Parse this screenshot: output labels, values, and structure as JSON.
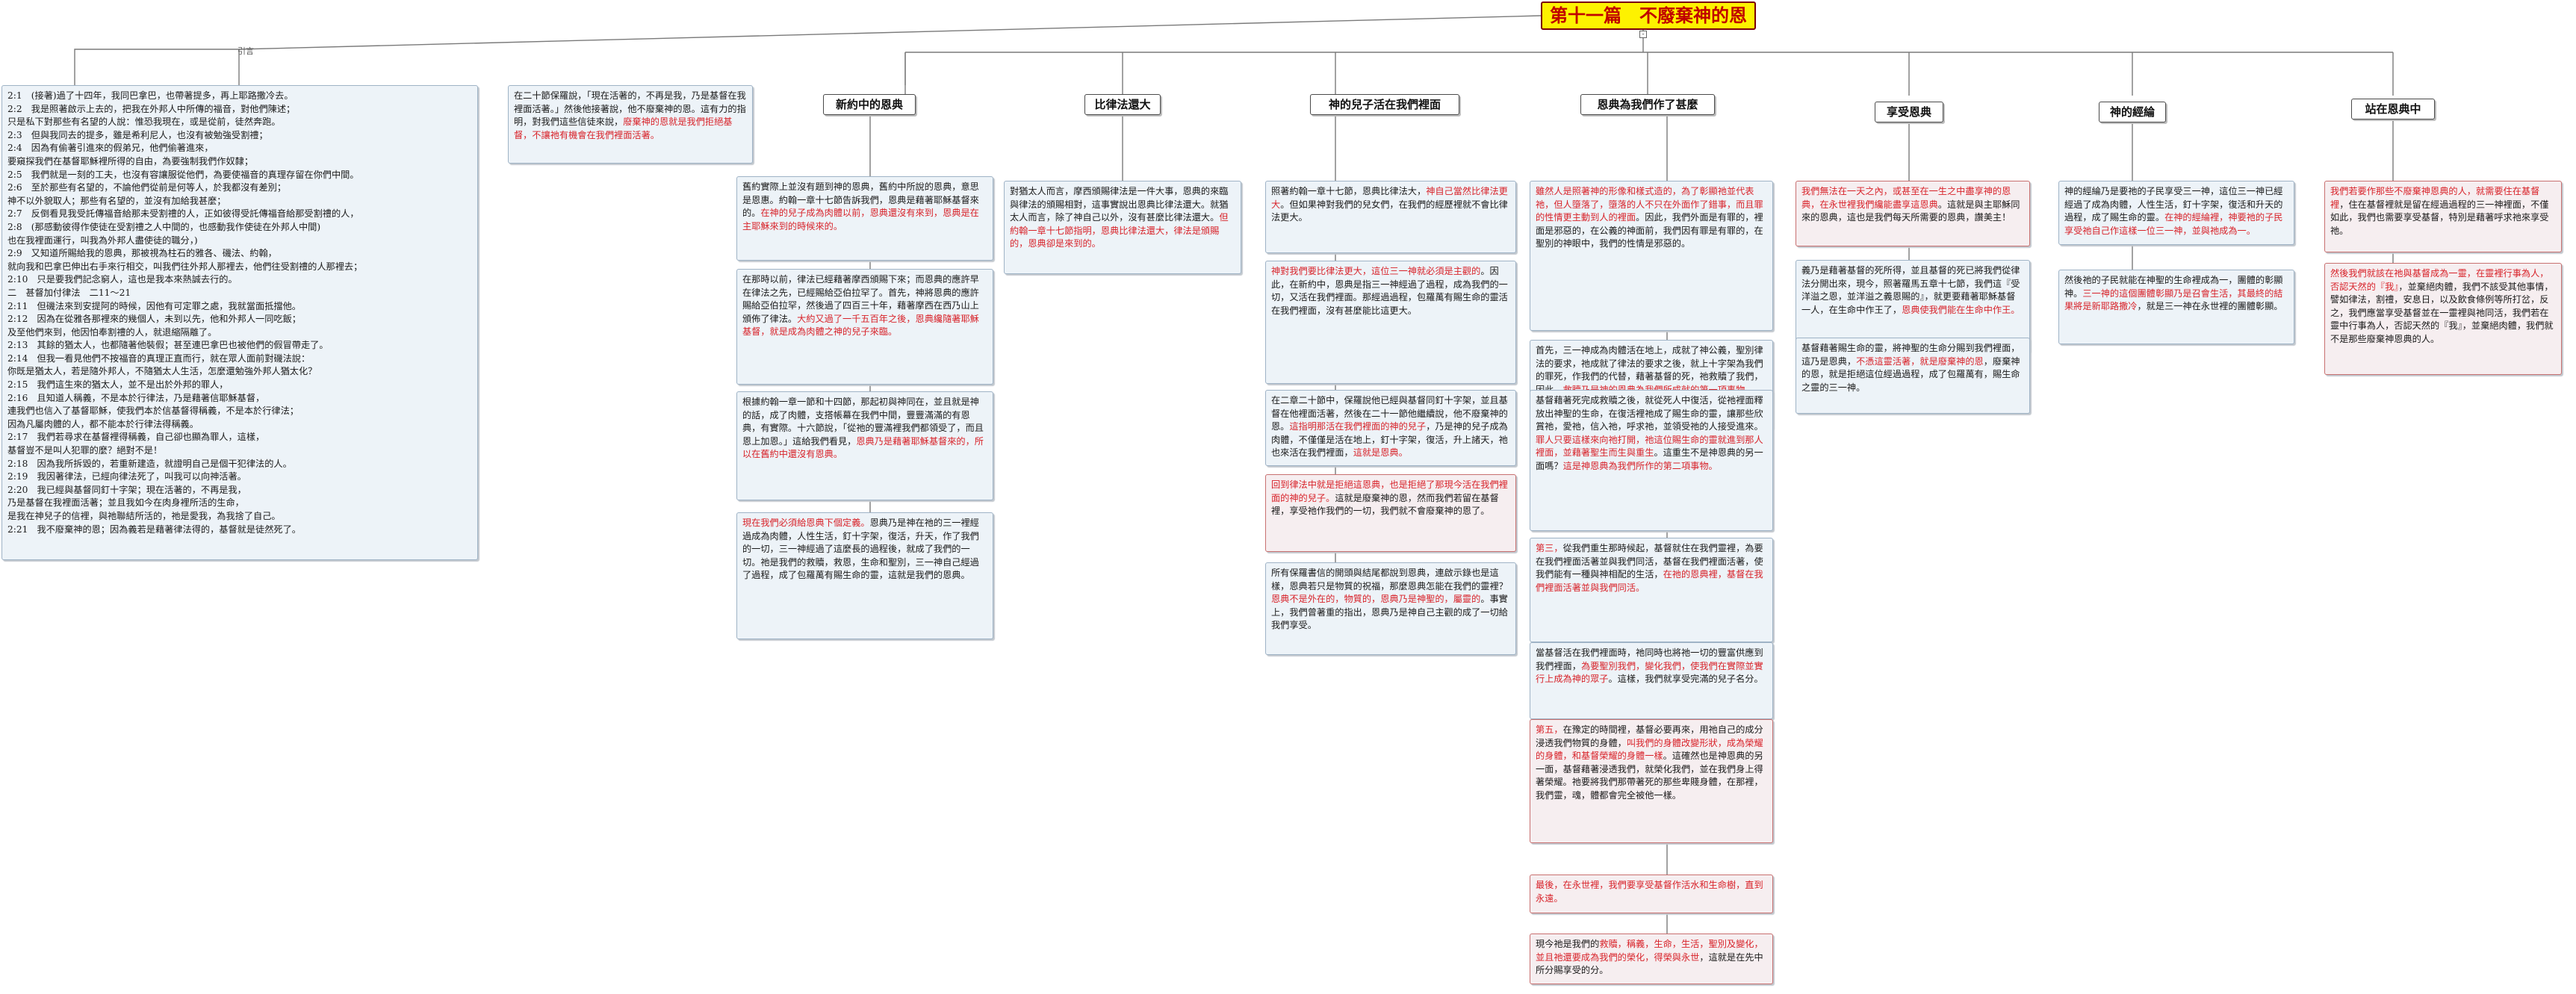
{
  "root": {
    "title": "第十一篇　不廢棄神的恩"
  },
  "branch_labels": {
    "left": "引言"
  },
  "topics": [
    {
      "id": "t1",
      "label": "新約中的恩典"
    },
    {
      "id": "t2",
      "label": "比律法還大"
    },
    {
      "id": "t3",
      "label": "神的兒子活在我們裡面"
    },
    {
      "id": "t4",
      "label": "恩典為我們作了甚麼"
    },
    {
      "id": "t5",
      "label": "享受恩典"
    },
    {
      "id": "t6",
      "label": "神的經綸"
    },
    {
      "id": "t7",
      "label": "站在恩典中"
    }
  ],
  "notes": {
    "intro": {
      "lines": [
        [
          {
            "t": "2:1　(接著)過了十四年，我同巴拿巴，也帶著提多，再上耶路撒冷去。"
          }
        ],
        [
          {
            "t": "2:2　我是照著啟示上去的，把我在外邦人中所傳的福音，對他們陳述；"
          }
        ],
        [
          {
            "t": "只是私下對那些有名望的人說：惟恐我現在，或是從前，徒然奔跑。"
          }
        ],
        [
          {
            "t": "2:3　但與我同去的提多，雖是希利尼人，也沒有被勉強受割禮；"
          }
        ],
        [
          {
            "t": "2:4　因為有偷著引進來的假弟兄，他們偷著進來，"
          }
        ],
        [
          {
            "t": "要窺探我們在基督耶穌裡所得的自由，為要強制我們作奴隸；"
          }
        ],
        [
          {
            "t": "2:5　我們就是一刻的工夫，也沒有容讓服從他們，為要使福音的真理存留在你們中間。"
          }
        ],
        [
          {
            "t": "2:6　至於那些有名望的，不論他們從前是何等人，於我都沒有差別；"
          }
        ],
        [
          {
            "t": "神不以外貌取人；那些有名望的，並沒有加給我甚麼；"
          }
        ],
        [
          {
            "t": "2:7　反倒看見我受託傳福音給那未受割禮的人，正如彼得受託傳福音給那受割禮的人，"
          }
        ],
        [
          {
            "t": "2:8　(那感動彼得作使徒在受割禮之人中間的，也感動我作使徒在外邦人中間)"
          }
        ],
        [
          {
            "t": "也在我裡面運行，叫我為外邦人盡使徒的職分，)"
          }
        ],
        [
          {
            "t": "2:9　又知道所賜給我的恩典，那被視為柱石的雅各、磯法、約翰，"
          }
        ],
        [
          {
            "t": "就向我和巴拿巴伸出右手來行相交，叫我們往外邦人那裡去，他們往受割禮的人那裡去；"
          }
        ],
        [
          {
            "t": "2:10　只是要我們記念窮人，這也是我本來熱誠去行的。"
          }
        ],
        [
          {
            "t": "二　甚督加付律法　二11～21"
          }
        ],
        [
          {
            "t": "2:11　但磯法來到安提阿的時候，因他有可定罪之處，我就當面抵擋他。"
          }
        ],
        [
          {
            "t": "2:12　因為在從雅各那裡來的幾個人，未到以先，他和外邦人一同吃飯；"
          }
        ],
        [
          {
            "t": "及至他們來到，他因怕奉割禮的人，就退縮隔離了。"
          }
        ],
        [
          {
            "t": "2:13　其餘的猶太人，也都隨著他裝假；甚至連巴拿巴也被他們的假冒帶走了。"
          }
        ],
        [
          {
            "t": "2:14　但我一看見他們不按福音的真理正直而行，就在眾人面前對磯法說："
          }
        ],
        [
          {
            "t": "你既是猶太人，若是隨外邦人，不隨猶太人生活，怎麼還勉強外邦人猶太化？"
          }
        ],
        [
          {
            "t": "2:15　我們這生來的猶太人，並不是出於外邦的罪人，"
          }
        ],
        [
          {
            "t": "2:16　且知道人稱義，不是本於行律法，乃是藉著信耶穌基督，"
          }
        ],
        [
          {
            "t": "連我們也信入了基督耶穌，使我們本於信基督得稱義，不是本於行律法；"
          }
        ],
        [
          {
            "t": "因為凡屬肉體的人，都不能本於行律法得稱義。"
          }
        ],
        [
          {
            "t": "2:17　我們若尋求在基督裡得稱義，自己卻也顯為罪人，這樣，"
          }
        ],
        [
          {
            "t": "基督豈不是叫人犯罪的麼？絕對不是！"
          }
        ],
        [
          {
            "t": "2:18　因為我所拆毀的，若重新建造，就證明自己是個干犯律法的人。"
          }
        ],
        [
          {
            "t": "2:19　我因著律法，已經向律法死了，叫我可以向神活著。"
          }
        ],
        [
          {
            "t": "2:20　我已經與基督同釘十字架；現在活著的，不再是我，"
          }
        ],
        [
          {
            "t": "乃是基督在我裡面活著；並且我如今在肉身裡所活的生命，"
          }
        ],
        [
          {
            "t": "是我在神兒子的信裡，與祂聯結所活的，祂是愛我，為我捨了自己。"
          }
        ],
        [
          {
            "t": "2:21　我不廢棄神的恩；因為義若是藉著律法得的，基督就是徒然死了。"
          }
        ]
      ]
    },
    "left_top": {
      "segs": [
        {
          "t": "在二十節保羅說，「現在活著的，不再是我，乃是基督在我裡面活著。」然後他接著說，他不廢棄神的恩。這有力的指明，對我們這些信徒來說，"
        },
        {
          "t": "廢棄神的恩就是我們拒絕基督，不讓祂有機會在我們裡面活著。",
          "r": true
        }
      ]
    },
    "n1a": {
      "segs": [
        {
          "t": "舊約實際上並沒有題到神的恩典，舊約中所說的恩典，意思是恩惠。約翰一章十七節告訴我們，恩典是藉著耶穌基督來的。"
        },
        {
          "t": "在神的兒子成為肉體以前，恩典還沒有來到，恩典是在主耶穌來到的時候來的。",
          "r": true
        }
      ]
    },
    "n1b": {
      "segs": [
        {
          "t": "在那時以前，律法已經藉著摩西頒賜下來；而恩典的應許早在律法之先，已經賜給亞伯拉罕了。首先，神將恩典的應許賜給亞伯拉罕，然後過了四百三十年，藉著摩西在西乃山上頒佈了律法。"
        },
        {
          "t": "大約又過了一千五百年之後，恩典纔隨著耶穌基督，就是成為肉體之神的兒子來臨。",
          "r": true
        }
      ]
    },
    "n1c": {
      "segs": [
        {
          "t": "根據約翰一章一節和十四節，那起初與神同在，並且就是神的話，成了肉體，支搭帳幕在我們中間，豐豐滿滿的有恩典，有實際。十六節說，「從祂的豐滿裡我們都領受了，而且恩上加恩。」這給我們看見，"
        },
        {
          "t": "恩典乃是藉著耶穌基督來的，所以在舊約中還沒有恩典。",
          "r": true
        }
      ]
    },
    "n1d": {
      "segs": [
        {
          "t": "現在我們必須給恩典下個定義。",
          "r": true
        },
        {
          "t": "恩典乃是神在祂的三一裡經過成為肉體，人性生活，釘十字架，復活，升天，作了我們的一切，三一神經過了這麼長的過程後，就成了我們的一切。祂是我們的救贖，救恩，生命和聖別，三一神自己經過了過程，成了包羅萬有賜生命的靈，這就是我們的恩典。"
        }
      ]
    },
    "n2a": {
      "segs": [
        {
          "t": "對猶太人而言，摩西頒賜律法是一件大事，恩典的來臨與律法的頒賜相對，這事實說出恩典比律法還大。就猶太人而言，除了神自己以外，沒有甚麼比律法還大。"
        },
        {
          "t": "但約翰一章十七節指明，恩典比律法還大，律法是頒賜的，恩典卻是來到的。",
          "r": true
        }
      ]
    },
    "n3a": {
      "segs": [
        {
          "t": "照著約翰一章十七節，恩典比律法大，"
        },
        {
          "t": "神自己當然比律法更大",
          "r": true
        },
        {
          "t": "。但如果神對我們的兒女們，在我們的經歷裡就不會比律法更大。"
        }
      ]
    },
    "n3b": {
      "segs": [
        {
          "t": "神對我們要比律法更大，這位三一神就必須是主觀的",
          "r": true
        },
        {
          "t": "。因此，在新約中，恩典是指三一神經過了過程，成為我們的一切，又活在我們裡面。那經過過程，包羅萬有賜生命的靈活在我們裡面，沒有甚麼能比這更大。"
        }
      ]
    },
    "n3c": {
      "segs": [
        {
          "t": "在二章二十節中，保羅說他已經與基督同釘十字架，並且基督在他裡面活著，然後在二十一節他繼續說，他不廢棄神的恩。"
        },
        {
          "t": "這指明那活在我們裡面的神的兒子",
          "r": true
        },
        {
          "t": "，乃是神的兒子成為肉體，不僅僅是活在地上，釘十字架，復活，升上諸天，祂也來活在我們裡面，"
        },
        {
          "t": "這就是恩典。",
          "r": true
        }
      ]
    },
    "n3d": {
      "segs": [
        {
          "t": "回到律法中就是拒絕這恩典，也是拒絕了那現今活在我們裡面的神的兒子。",
          "r": true
        },
        {
          "t": "這就是廢棄神的恩，然而我們若留在基督裡，享受祂作我們的一切，我們就不會廢棄神的恩了。"
        }
      ]
    },
    "n3e": {
      "segs": [
        {
          "t": "所有保羅書信的開頭與結尾都說到恩典，連啟示錄也是這樣，恩典若只是物質的祝福，那麼恩典怎能在我們的靈裡？"
        },
        {
          "t": "恩典不是外在的，物質的，恩典乃是神聖的，屬靈的",
          "r": true
        },
        {
          "t": "。事實上，我們曾著重的指出，恩典乃是神自己主觀的成了一切給我們享受。"
        }
      ]
    },
    "n4a": {
      "segs": [
        {
          "t": "雖然人是照著神的形像和樣式造的，為了彰顯祂並代表祂，但人墮落了，墮落的人不只在外面作了錯事，而且罪的性情更主動到人的裡面",
          "r": true
        },
        {
          "t": "。因此，我們外面是有罪的，裡面是邪惡的，在公義的神面前，我們因有罪是有罪的，在聖別的神眼中，我們的性情是邪惡的。"
        }
      ]
    },
    "n4b": {
      "segs": [
        {
          "t": "首先，三一神成為肉體活在地上，成就了神公義，聖別律法的要求，祂成就了律法的要求之後，就上十字架為我們的罪死，作我們的代替，藉著基督的死，祂救贖了我們，因此，"
        },
        {
          "t": "救贖乃是神的恩典為我們所成就的第一項事物。",
          "r": true
        }
      ]
    },
    "n4c": {
      "segs": [
        {
          "t": "基督藉著死完成救贖之後，就從死人中復活，從祂裡面釋放出神聖的生命，在復活裡祂成了賜生命的靈，讓那些欣賞祂，愛祂，信入祂，呼求祂，並領受祂的人接受進來。"
        },
        {
          "t": "罪人只要這樣來向祂打開，祂這位賜生命的靈就進到那人裡面，並藉著聖生而生與重生",
          "r": true
        },
        {
          "t": "。這重生不是神恩典的另一面嗎？"
        },
        {
          "t": "這是神恩典為我們所作的第二項事物。",
          "r": true
        }
      ]
    },
    "n4d": {
      "segs": [
        {
          "t": "第三，",
          "r": true
        },
        {
          "t": "從我們重生那時候起，基督就住在我們靈裡，為要在我們裡面活著並與我們同活，基督在我們裡面活著，使我們能有一種與神相配的生活，"
        },
        {
          "t": "在祂的恩典裡，基督在我們裡面活著並與我們同活。",
          "r": true
        }
      ]
    },
    "n4e": {
      "segs": [
        {
          "t": "當基督活在我們裡面時，祂同時也將祂一切的豐富供應到我們裡面，"
        },
        {
          "t": "為要聖別我們，變化我們，使我們在實際並實行上成為神的眾子",
          "r": true
        },
        {
          "t": "。這樣，我們就享受完滿的兒子名分。"
        }
      ]
    },
    "n4f": {
      "segs": [
        {
          "t": "第五，",
          "r": true
        },
        {
          "t": "在豫定的時間裡，基督必要再來，用祂自己的成分浸透我們物質的身體，"
        },
        {
          "t": "叫我們的身體改變形狀，成為榮耀的身體，和基督榮耀的身體一樣",
          "r": true
        },
        {
          "t": "。這確然也是神恩典的另一面，基督藉著浸透我們，就榮化我們，並在我們身上得著榮耀。祂要將我們那帶著死的那些卑賤身體，在那裡，我們靈，魂，體都會完全被他一樣。"
        }
      ]
    },
    "n4g": {
      "segs": [
        {
          "t": "最後，在永世裡，我們要享受基督作活水和生命樹，直到永遠。",
          "r": true
        }
      ]
    },
    "n4h": {
      "segs": [
        {
          "t": "現今祂是我們的"
        },
        {
          "t": "救贖，稱義，生命，生活，聖別及變化，並且祂還要成為我們的榮化，得榮與永世",
          "r": true
        },
        {
          "t": "，這就是在先中所分賜享受的分。"
        }
      ]
    },
    "n5a": {
      "segs": [
        {
          "t": "我們無法在一天之內，或甚至在一生之中盡享神的恩典，在永世裡我們纔能盡享這恩典",
          "r": true
        },
        {
          "t": "。這就是與主耶穌同來的恩典，這也是我們每天所需要的恩典，讚美主！"
        }
      ]
    },
    "n5b": {
      "segs": [
        {
          "t": "義乃是藉著基督的死所得，並且基督的死已將我們從律法分開出來，現今，照著羅馬五章十七節，我們這『受洋溢之恩，並洋溢之義恩賜的』，就更要藉著耶穌基督一人，在生命中作王了，"
        },
        {
          "t": "恩典使我們能在生命中作王。",
          "r": true
        }
      ]
    },
    "n5c": {
      "segs": [
        {
          "t": "基督藉著賜生命的靈，將神聖的生命分賜到我們裡面，這乃是恩典，"
        },
        {
          "t": "不憑這靈活著，就是廢棄神的恩",
          "r": true
        },
        {
          "t": "，廢棄神的恩，就是拒絕這位經過過程，成了包羅萬有，賜生命之靈的三一神。"
        }
      ]
    },
    "n6a": {
      "segs": [
        {
          "t": "神的經綸乃是要祂的子民享受三一神，這位三一神已經經過了成為肉體，人性生活，釘十字架，復活和升天的過程，成了賜生命的靈。"
        },
        {
          "t": "在神的經綸裡，神要祂的子民享受祂自己作這樣一位三一神，並與祂成為一。",
          "r": true
        }
      ]
    },
    "n6b": {
      "segs": [
        {
          "t": "然後祂的子民就能在神聖的生命裡成為一，團體的彰顯神。"
        },
        {
          "t": "三一神的這個團體彰顯乃是召會生活，其最終的結果將是新耶路撒冷",
          "r": true
        },
        {
          "t": "，就是三一神在永世裡的團體彰顯。"
        }
      ]
    },
    "n7a": {
      "segs": [
        {
          "t": "我們若要作那些不廢棄神恩典的人，就需要住在基督裡",
          "r": true
        },
        {
          "t": "，住在基督裡就是留在經過過程的三一神裡面，不僅如此，我們也需要享受基督，特別是藉著呼求祂來享受祂。"
        }
      ]
    },
    "n7b": {
      "segs": [
        {
          "t": "然後我們就該在祂與基督成為一靈，在靈裡行事為人，否認天然的『我』",
          "r": true
        },
        {
          "t": "，並棄絕肉體，我們不該受其他事情，譬如律法，割禮，安息日，以及飲食條例等所打岔，反之，我們應當享受基督並在一靈裡與祂同活，我們若在靈中行事為人，否認天然的『我』，並棄絕肉體，我們就不是那些廢棄神恩典的人。"
        }
      ]
    }
  }
}
